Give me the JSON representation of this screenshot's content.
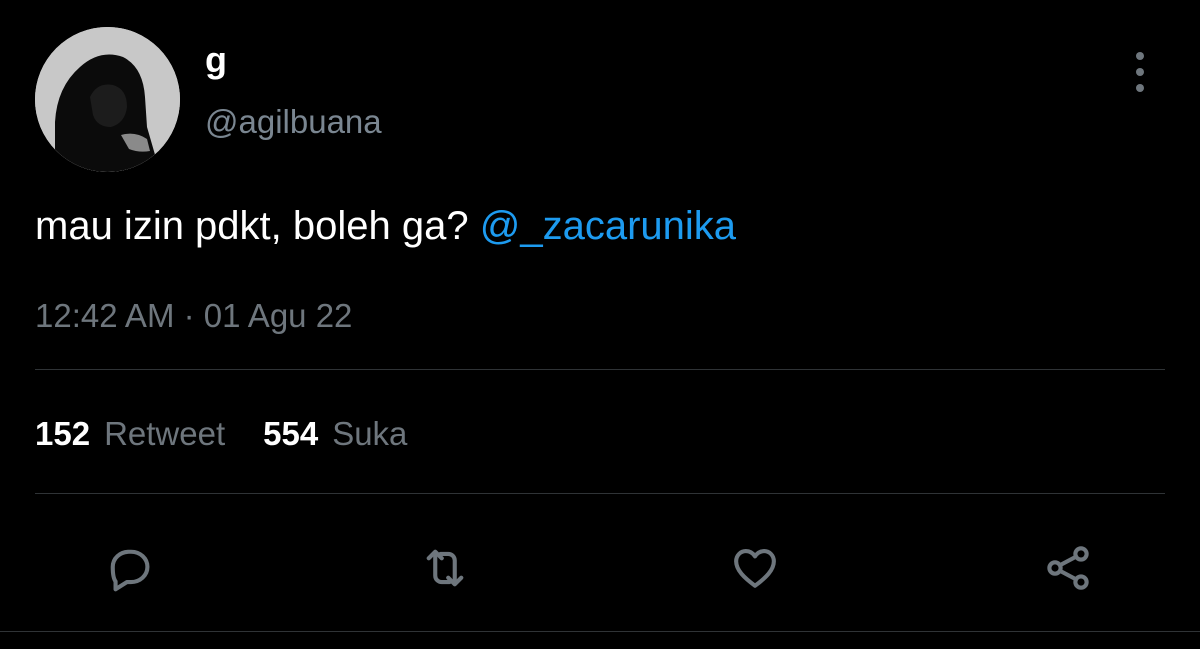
{
  "tweet": {
    "author": {
      "display_name": "g",
      "handle": "@agilbuana"
    },
    "text": "mau izin pdkt, boleh ga?",
    "mention": "@_zacarunika",
    "timestamp": "12:42 AM · 01 Agu 22",
    "stats": {
      "retweets_count": "152",
      "retweets_label": "Retweet",
      "likes_count": "554",
      "likes_label": "Suka"
    }
  },
  "actions": [
    {
      "name": "reply",
      "icon": "reply-icon"
    },
    {
      "name": "retweet",
      "icon": "retweet-icon"
    },
    {
      "name": "like",
      "icon": "heart-icon"
    },
    {
      "name": "share",
      "icon": "share-icon"
    }
  ],
  "colors": {
    "background": "#000000",
    "mention": "#1d9bf0",
    "secondary_text": "#6e767d",
    "divider": "#2f3336"
  }
}
